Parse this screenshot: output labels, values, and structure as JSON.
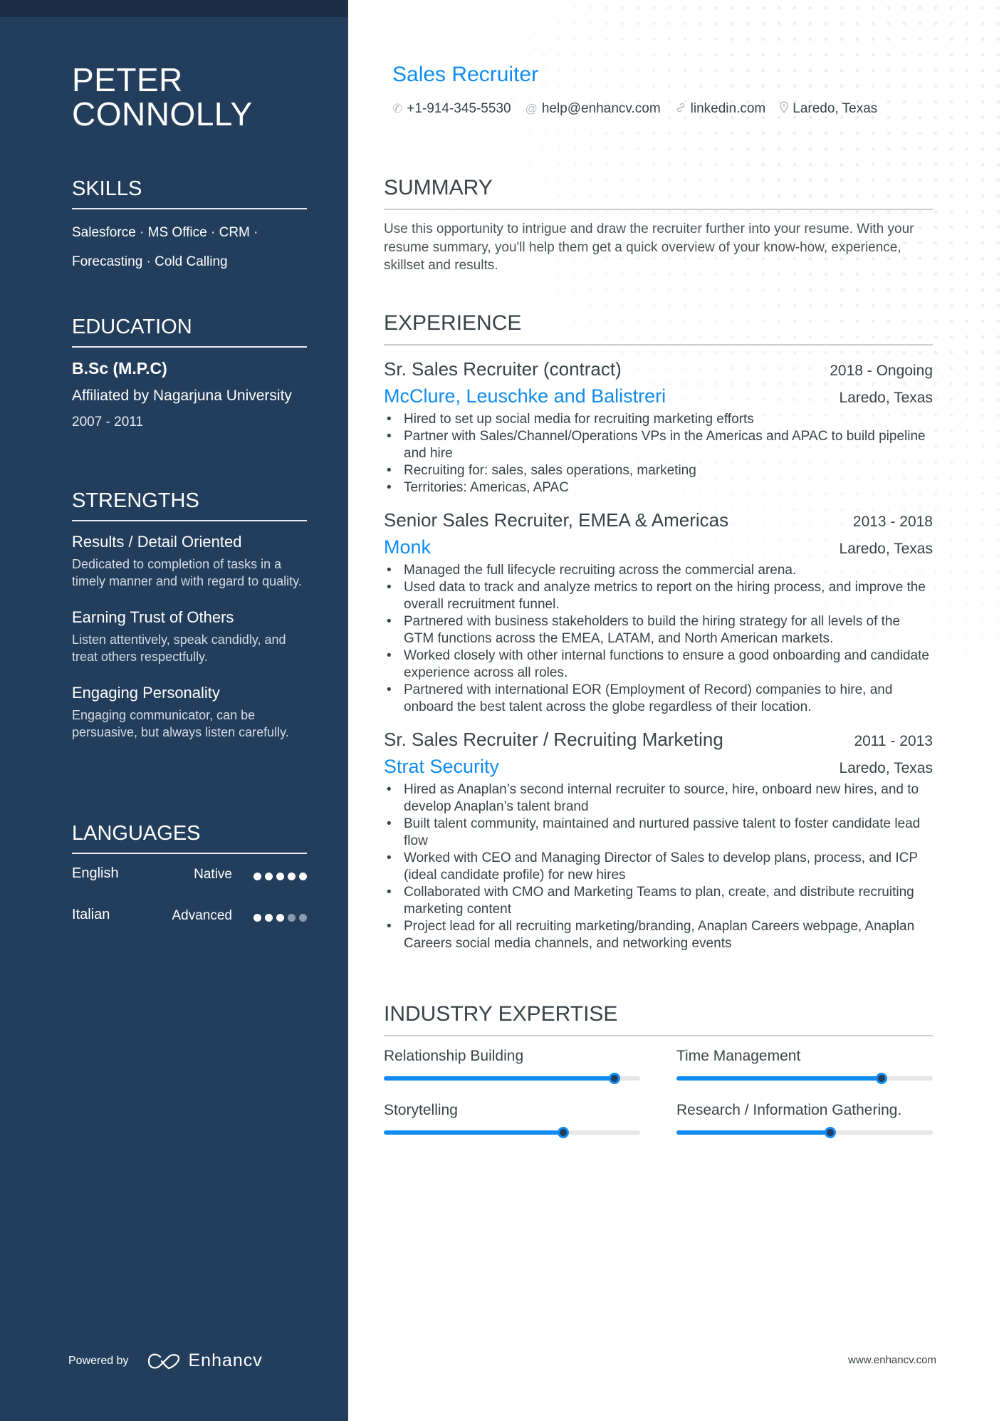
{
  "profile": {
    "name_line1": "PETER",
    "name_line2": "CONNOLLY",
    "title": "Sales Recruiter",
    "contacts": [
      {
        "icon": "phone-icon",
        "glyph": "✆",
        "text": "+1-914-345-5530"
      },
      {
        "icon": "at-icon",
        "glyph": "@",
        "text": "help@enhancv.com"
      },
      {
        "icon": "link-icon",
        "glyph": "🔗︎",
        "text": "linkedin.com"
      },
      {
        "icon": "location-pin-icon",
        "glyph": "⚲",
        "text": "Laredo, Texas"
      }
    ]
  },
  "sidebar": {
    "skills": {
      "heading": "SKILLS",
      "line1": "Salesforce · MS Office · CRM ·",
      "line2": "Forecasting · Cold Calling"
    },
    "education": {
      "heading": "EDUCATION",
      "degree": "B.Sc (M.P.C)",
      "school": "Affiliated by Nagarjuna University",
      "dates": "2007 - 2011"
    },
    "strengths": {
      "heading": "STRENGTHS",
      "items": [
        {
          "title": "Results / Detail Oriented",
          "desc": "Dedicated to completion of tasks in a timely manner and with regard to quality."
        },
        {
          "title": "Earning Trust of Others",
          "desc": "Listen attentively, speak candidly, and treat others respectfully."
        },
        {
          "title": "Engaging Personality",
          "desc": "Engaging communicator, can be persuasive, but always listen carefully."
        }
      ]
    },
    "languages": {
      "heading": "LANGUAGES",
      "items": [
        {
          "name": "English",
          "level": "Native",
          "rating": 5,
          "max": 5
        },
        {
          "name": "Italian",
          "level": "Advanced",
          "rating": 3,
          "max": 5
        }
      ]
    },
    "footer": {
      "powered_by": "Powered by",
      "brand": "Enhancv"
    }
  },
  "summary": {
    "heading": "SUMMARY",
    "text": "Use this opportunity to intrigue and draw the recruiter further into your resume. With your resume summary, you'll help them get a quick overview of your know-how, experience, skillset and results."
  },
  "experience": {
    "heading": "EXPERIENCE",
    "jobs": [
      {
        "title": "Sr. Sales Recruiter (contract)",
        "dates": "2018 - Ongoing",
        "company": "McClure, Leuschke and Balistreri",
        "location": "Laredo, Texas",
        "bullets": [
          "Hired to set up social media for recruiting marketing efforts",
          "Partner with Sales/Channel/Operations VPs in the Americas and APAC to build pipeline and hire",
          "Recruiting for: sales, sales operations, marketing",
          "Territories: Americas, APAC"
        ]
      },
      {
        "title": "Senior Sales Recruiter, EMEA & Americas",
        "dates": "2013 - 2018",
        "company": "Monk",
        "location": "Laredo, Texas",
        "bullets": [
          "Managed the full lifecycle recruiting across the commercial arena.",
          "Used data to track and analyze metrics to report on the hiring process, and improve the overall recruitment funnel.",
          "Partnered with business stakeholders to build the hiring strategy for all levels of the GTM functions across the EMEA, LATAM, and North American markets.",
          "Worked closely with other internal functions to ensure a good onboarding and candidate experience across all roles.",
          "Partnered with international EOR (Employment of Record) companies to hire, and onboard the best talent across the globe regardless of their location."
        ]
      },
      {
        "title": "Sr. Sales Recruiter / Recruiting Marketing",
        "dates": "2011 - 2013",
        "company": "Strat Security",
        "location": "Laredo, Texas",
        "bullets": [
          "Hired as Anaplan’s second internal recruiter to source, hire, onboard new hires, and to develop Anaplan’s talent brand",
          "Built talent community, maintained and nurtured passive talent to foster candidate lead flow",
          "Worked with CEO and Managing Director of Sales to develop plans, process, and ICP (ideal candidate profile) for new hires",
          "Collaborated with CMO and Marketing Teams to plan, create, and distribute recruiting marketing content",
          "Project lead for all recruiting marketing/branding, Anaplan Careers webpage, Anaplan Careers social media channels, and networking events"
        ]
      }
    ]
  },
  "industry_expertise": {
    "heading": "INDUSTRY EXPERTISE",
    "items": [
      {
        "label": "Relationship Building",
        "percent": 90
      },
      {
        "label": "Time Management",
        "percent": 80
      },
      {
        "label": "Storytelling",
        "percent": 70
      },
      {
        "label": "Research / Information Gathering.",
        "percent": 60
      }
    ]
  },
  "footer": {
    "website": "www.enhancv.com"
  },
  "colors": {
    "sidebar": "#233e5c",
    "accent": "#0f8cf2",
    "text": "#384347"
  }
}
